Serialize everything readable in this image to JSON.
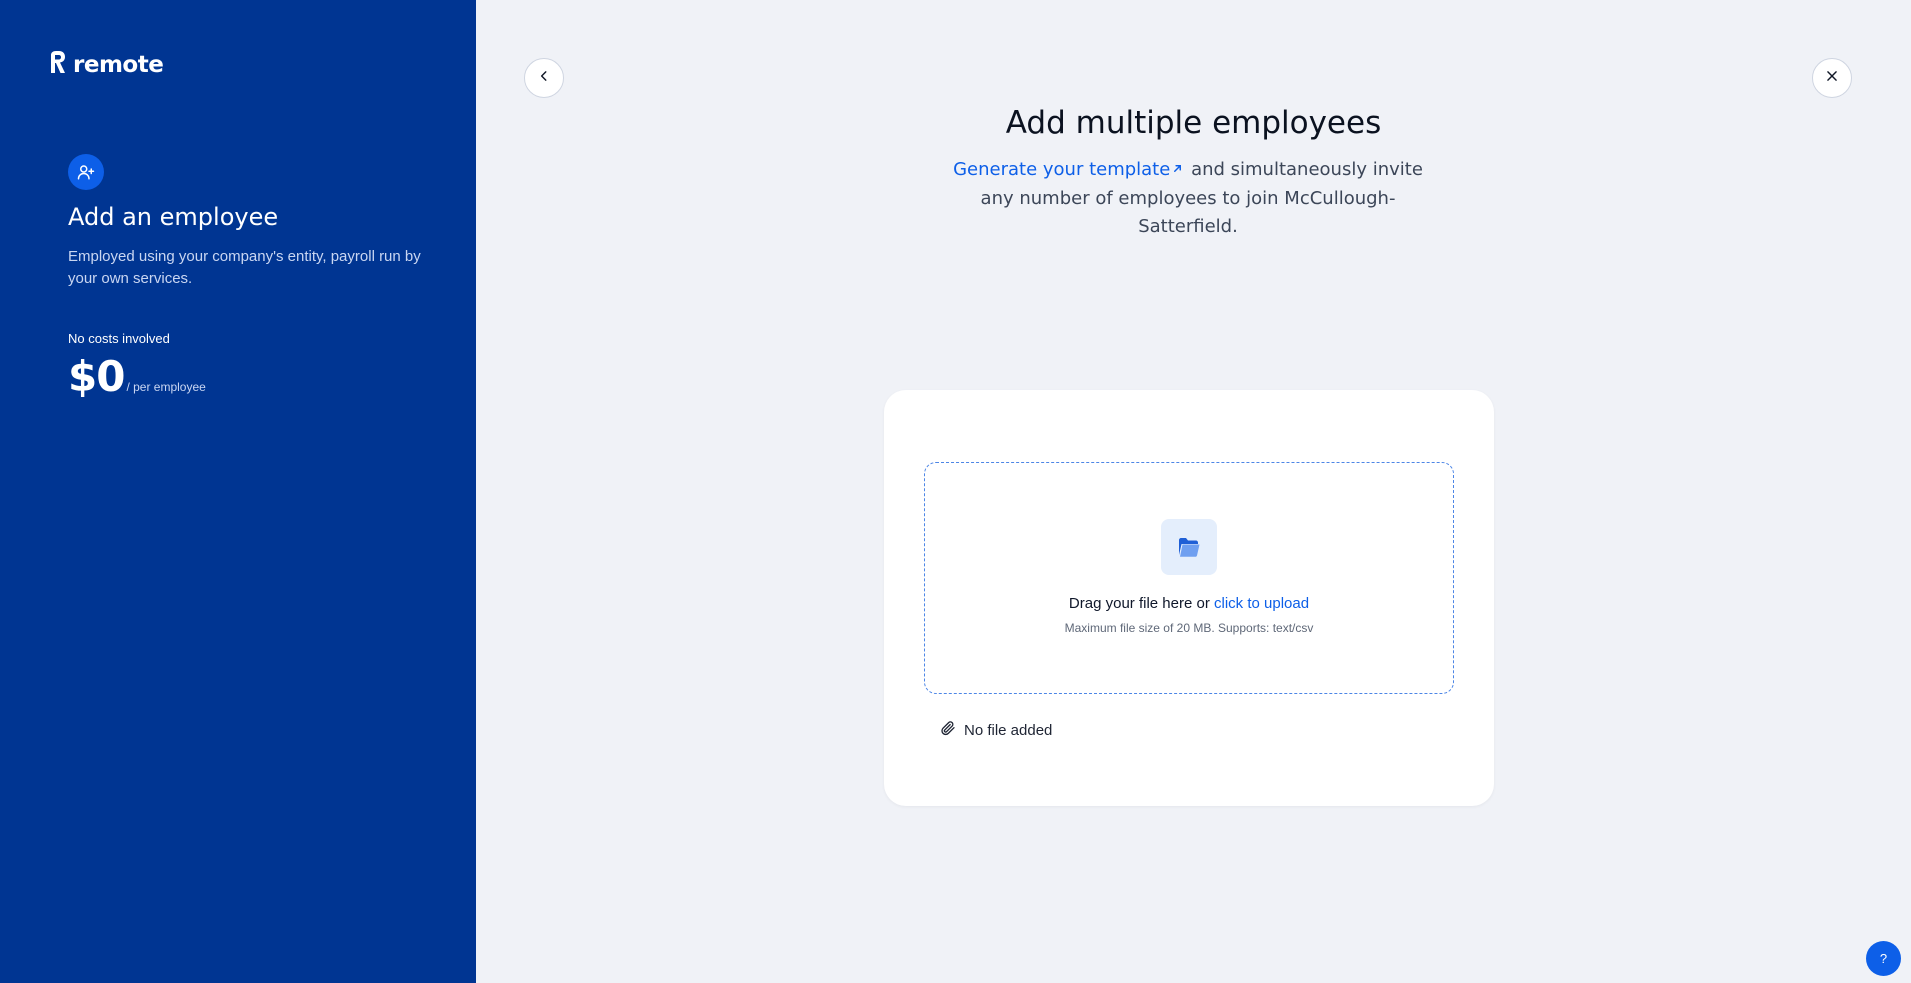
{
  "brand": {
    "logo_text": "remote"
  },
  "sidebar": {
    "title": "Add an employee",
    "description": "Employed using your company's entity, payroll run by your own services.",
    "cost_label": "No costs involved",
    "price": "$0",
    "price_unit": "/ per employee"
  },
  "header": {
    "title": "Add multiple employees",
    "link_text": "Generate your template",
    "subtitle_rest": " and simultaneously invite any number of employees to join McCullough-Satterfield."
  },
  "upload": {
    "drag_text": "Drag your file here or ",
    "click_text": "click to upload",
    "hint": "Maximum file size of 20 MB. Supports: text/csv",
    "status": "No file added"
  },
  "help": {
    "label": "?"
  },
  "colors": {
    "sidebar_bg": "#003592",
    "accent": "#0d5fe8",
    "page_bg": "#f0f2f7"
  },
  "icons": {
    "logo": "remote-logo-icon",
    "employee": "user-plus-icon",
    "back": "chevron-left-icon",
    "close": "close-icon",
    "external": "external-link-icon",
    "folder": "folder-icon",
    "attachment": "paperclip-icon"
  }
}
